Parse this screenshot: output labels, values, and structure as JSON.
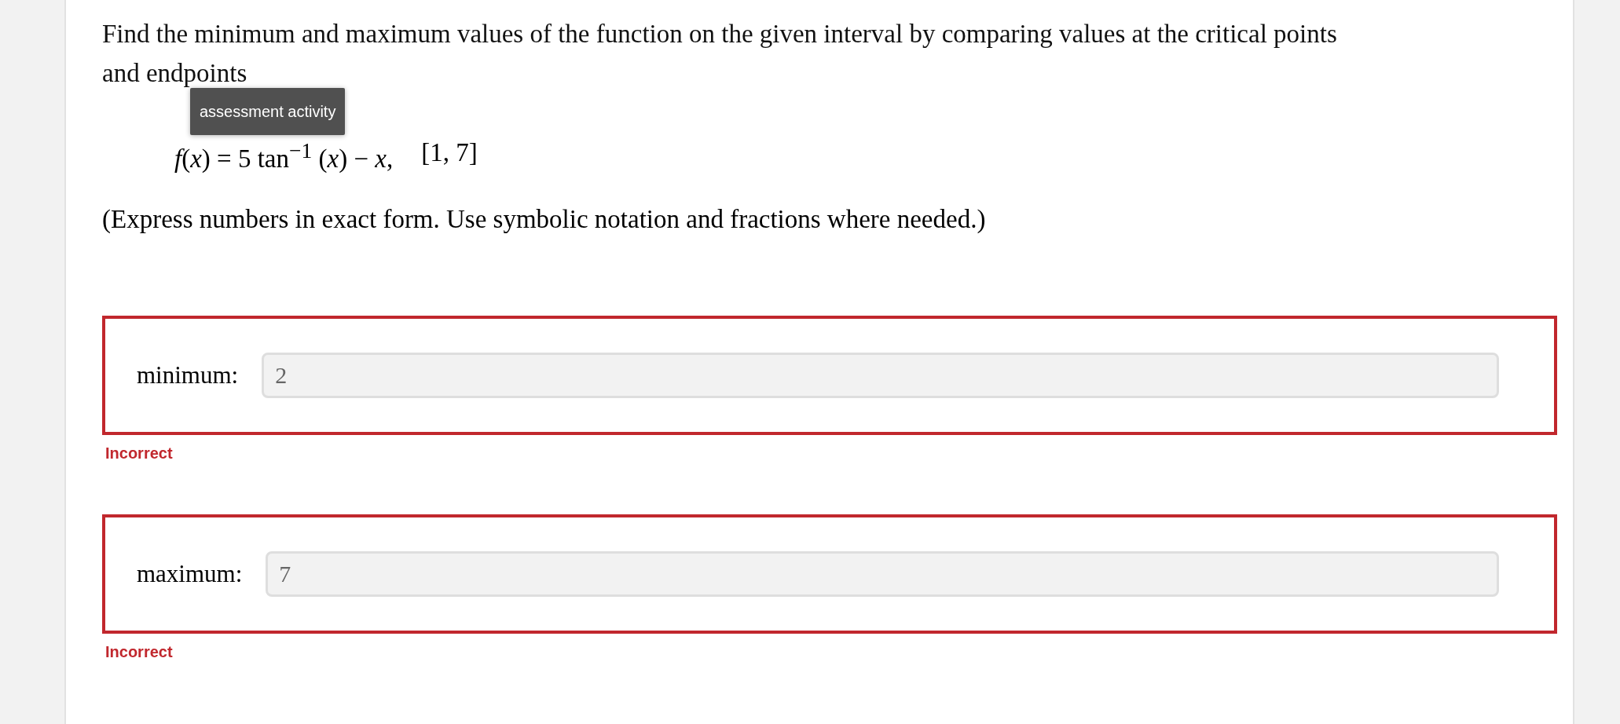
{
  "question": "Find the minimum and maximum values of the function on the given interval by comparing values at the critical points and endpoints",
  "tooltip": "assessment activity",
  "formula": {
    "expression": "*f*(*x*) = 5 tan$^{−1}$ (*x*) − *x*,",
    "interval": "[1, 7]"
  },
  "instruction": "(Express numbers in exact form. Use symbolic notation and fractions where needed.)",
  "answers": [
    {
      "label": "minimum:",
      "value": "2",
      "correct": false,
      "feedback": "Incorrect"
    },
    {
      "label": "maximum:",
      "value": "7",
      "correct": false,
      "feedback": "Incorrect"
    }
  ]
}
